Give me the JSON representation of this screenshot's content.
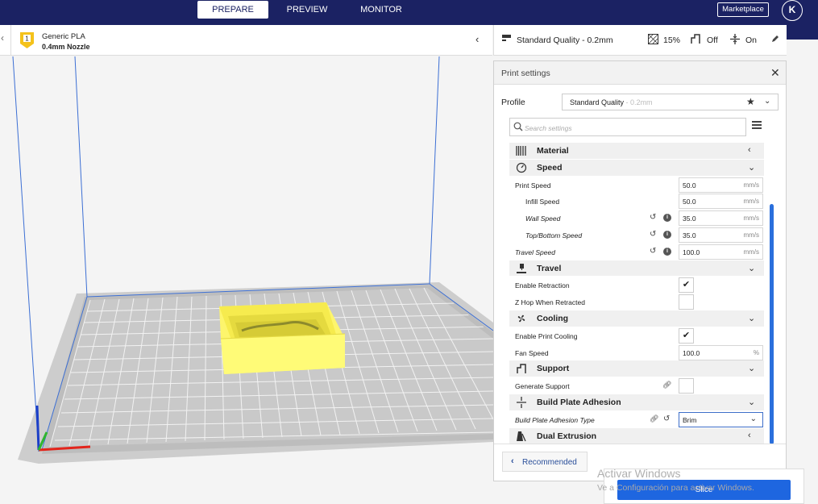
{
  "stages": [
    {
      "label": "PREPARE",
      "active": true
    },
    {
      "label": "PREVIEW",
      "active": false
    },
    {
      "label": "MONITOR",
      "active": false
    }
  ],
  "header": {
    "marketplace_label": "Marketplace",
    "account_initial": "K"
  },
  "material": {
    "extruder_number": "1",
    "name": "Generic PLA",
    "nozzle": "0.4mm Nozzle",
    "badge_color": "#f4c21b"
  },
  "settings_bar": {
    "profile": "Standard Quality - 0.2mm",
    "infill": "15%",
    "support": "Off",
    "adhesion": "On"
  },
  "panel": {
    "title": "Print settings",
    "profile_label": "Profile",
    "profile_name": "Standard Quality",
    "profile_sub": " - 0.2mm",
    "search_placeholder": "Search settings",
    "recommended_label": "Recommended",
    "rows": [
      {
        "type": "category",
        "name": "Material",
        "icon": "material-icon",
        "chevron": "‹"
      },
      {
        "type": "category",
        "name": "Speed",
        "icon": "speed-icon",
        "chevron": "⌄"
      },
      {
        "type": "setting",
        "label": "Print Speed",
        "value": "50.0",
        "unit": "mm/s",
        "indent": false,
        "italic": false
      },
      {
        "type": "setting",
        "label": "Infill Speed",
        "value": "50.0",
        "unit": "mm/s",
        "indent": true,
        "italic": false
      },
      {
        "type": "setting",
        "label": "Wall Speed",
        "value": "35.0",
        "unit": "mm/s",
        "indent": true,
        "italic": true,
        "reset": true
      },
      {
        "type": "setting",
        "label": "Top/Bottom Speed",
        "value": "35.0",
        "unit": "mm/s",
        "indent": true,
        "italic": true,
        "reset": true
      },
      {
        "type": "setting",
        "label": "Travel Speed",
        "value": "100.0",
        "unit": "mm/s",
        "indent": false,
        "italic": true,
        "reset": true
      },
      {
        "type": "category",
        "name": "Travel",
        "icon": "travel-icon",
        "chevron": "⌄"
      },
      {
        "type": "check",
        "label": "Enable Retraction",
        "checked": true
      },
      {
        "type": "check",
        "label": "Z Hop When Retracted",
        "checked": false
      },
      {
        "type": "category",
        "name": "Cooling",
        "icon": "fan-icon",
        "chevron": "⌄"
      },
      {
        "type": "check",
        "label": "Enable Print Cooling",
        "checked": true
      },
      {
        "type": "setting",
        "label": "Fan Speed",
        "value": "100.0",
        "unit": "%",
        "indent": false,
        "italic": false
      },
      {
        "type": "category",
        "name": "Support",
        "icon": "support-icon",
        "chevron": "⌄"
      },
      {
        "type": "check",
        "label": "Generate Support",
        "checked": false,
        "link": true
      },
      {
        "type": "category",
        "name": "Build Plate Adhesion",
        "icon": "adhesion-icon",
        "chevron": "⌄"
      },
      {
        "type": "select",
        "label": "Build Plate Adhesion Type",
        "value": "Brim",
        "italic": true
      },
      {
        "type": "category",
        "name": "Dual Extrusion",
        "icon": "dual-extrusion-icon",
        "chevron": "‹"
      }
    ]
  },
  "slice_label": "Slice",
  "watermark": {
    "line1": "Activar Windows",
    "line2": "Ve a Configuración para activar Windows."
  },
  "colors": {
    "topbar": "#1b2263",
    "accent": "#1e66e0",
    "model": "#fdf56c",
    "bed": "#c9c9c9"
  }
}
